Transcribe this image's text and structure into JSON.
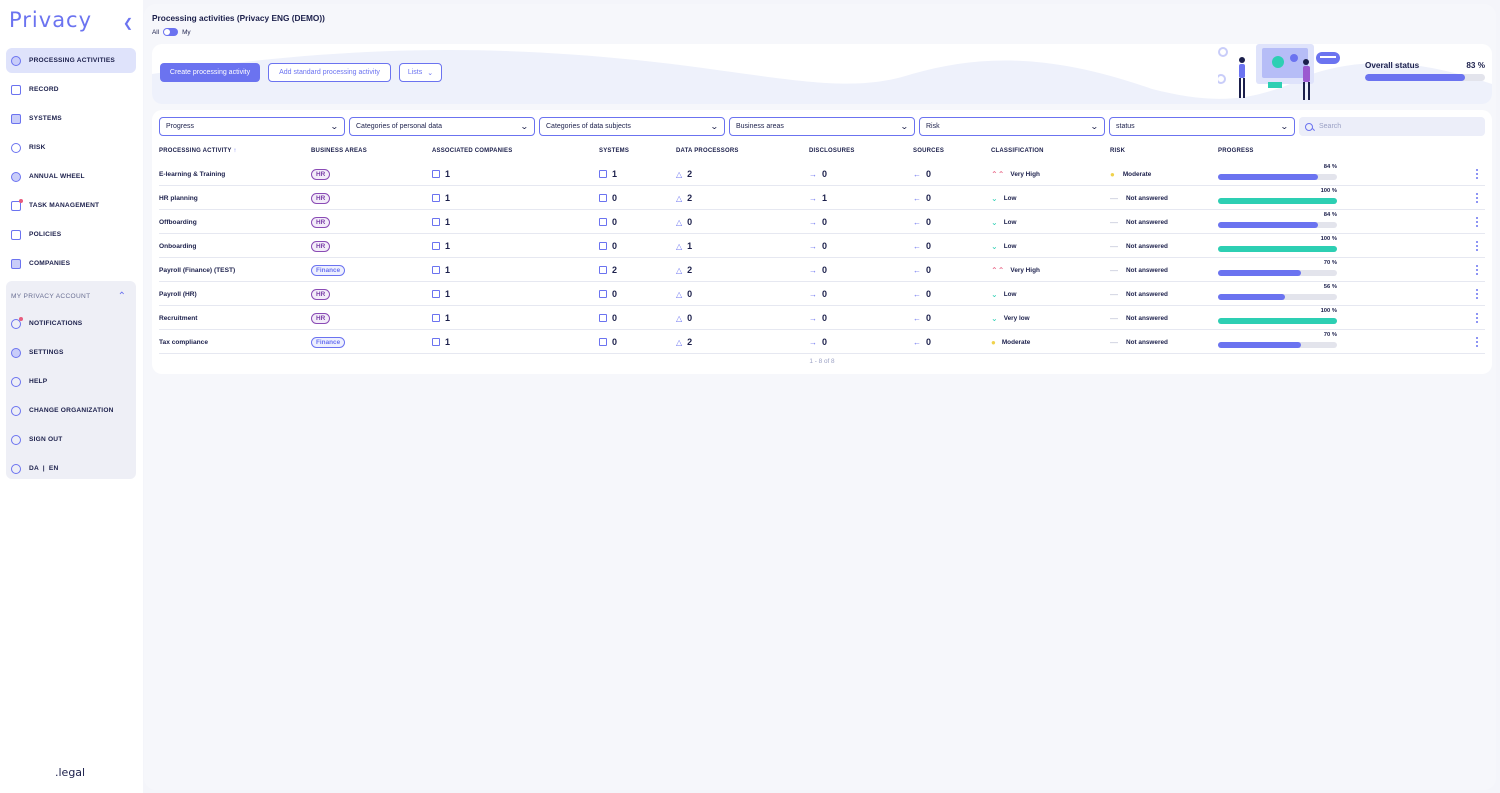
{
  "app": {
    "logo": "Privacy",
    "brand": ".legal",
    "accent": "#6b73f0"
  },
  "sidebar": {
    "items": [
      {
        "label": "PROCESSING ACTIVITIES",
        "icon": "fingerprint-icon",
        "active": true
      },
      {
        "label": "RECORD",
        "icon": "document-icon"
      },
      {
        "label": "SYSTEMS",
        "icon": "systems-icon"
      },
      {
        "label": "RISK",
        "icon": "gauge-icon"
      },
      {
        "label": "ANNUAL WHEEL",
        "icon": "wheel-icon"
      },
      {
        "label": "TASK MANAGEMENT",
        "icon": "tasks-icon"
      },
      {
        "label": "POLICIES",
        "icon": "policies-icon"
      },
      {
        "label": "COMPANIES",
        "icon": "companies-icon"
      }
    ],
    "account": {
      "title": "MY PRIVACY ACCOUNT",
      "items": [
        {
          "label": "NOTIFICATIONS",
          "icon": "bell-icon"
        },
        {
          "label": "SETTINGS",
          "icon": "gear-icon"
        },
        {
          "label": "HELP",
          "icon": "help-icon"
        },
        {
          "label": "CHANGE ORGANIZATION",
          "icon": "swap-icon"
        },
        {
          "label": "SIGN OUT",
          "icon": "sign-out-icon"
        },
        {
          "label": "DA  |  EN",
          "icon": "globe-icon"
        }
      ]
    }
  },
  "header": {
    "title": "Processing activities (Privacy ENG (DEMO))",
    "toggle_left": "All",
    "toggle_right": "My"
  },
  "toolbar": {
    "create": "Create processing activity",
    "add_standard": "Add standard processing activity",
    "lists": "Lists"
  },
  "overall": {
    "label": "Overall status",
    "percent_text": "83 %",
    "value": 83
  },
  "filters": {
    "items": [
      "Progress",
      "Categories of personal data",
      "Categories of data subjects",
      "Business areas",
      "Risk",
      "status"
    ],
    "search_placeholder": "Search"
  },
  "table": {
    "columns": [
      "PROCESSING ACTIVITY",
      "BUSINESS AREAS",
      "ASSOCIATED COMPANIES",
      "SYSTEMS",
      "DATA PROCESSORS",
      "DISCLOSURES",
      "SOURCES",
      "CLASSIFICATION",
      "RISK",
      "PROGRESS"
    ],
    "rows": [
      {
        "name": "E-learning & Training",
        "area": "HR",
        "companies": "1",
        "systems": "1",
        "processors": "2",
        "disclosures": "0",
        "sources": "0",
        "classification": "Very High",
        "class_icon": "double-up",
        "risk": "Moderate",
        "risk_icon": "dot",
        "progress": 84,
        "progress_text": "84 %"
      },
      {
        "name": "HR planning",
        "area": "HR",
        "companies": "1",
        "systems": "0",
        "processors": "2",
        "disclosures": "1",
        "sources": "0",
        "classification": "Low",
        "class_icon": "down",
        "risk": "Not answered",
        "risk_icon": "dash",
        "progress": 100,
        "progress_text": "100 %"
      },
      {
        "name": "Offboarding",
        "area": "HR",
        "companies": "1",
        "systems": "0",
        "processors": "0",
        "disclosures": "0",
        "sources": "0",
        "classification": "Low",
        "class_icon": "down",
        "risk": "Not answered",
        "risk_icon": "dash",
        "progress": 84,
        "progress_text": "84 %"
      },
      {
        "name": "Onboarding",
        "area": "HR",
        "companies": "1",
        "systems": "0",
        "processors": "1",
        "disclosures": "0",
        "sources": "0",
        "classification": "Low",
        "class_icon": "down",
        "risk": "Not answered",
        "risk_icon": "dash",
        "progress": 100,
        "progress_text": "100 %"
      },
      {
        "name": "Payroll (Finance) (TEST)",
        "area": "Finance",
        "companies": "1",
        "systems": "2",
        "processors": "2",
        "disclosures": "0",
        "sources": "0",
        "classification": "Very High",
        "class_icon": "double-up",
        "risk": "Not answered",
        "risk_icon": "dash",
        "progress": 70,
        "progress_text": "70 %"
      },
      {
        "name": "Payroll (HR)",
        "area": "HR",
        "companies": "1",
        "systems": "0",
        "processors": "0",
        "disclosures": "0",
        "sources": "0",
        "classification": "Low",
        "class_icon": "down",
        "risk": "Not answered",
        "risk_icon": "dash",
        "progress": 56,
        "progress_text": "56 %"
      },
      {
        "name": "Recruitment",
        "area": "HR",
        "companies": "1",
        "systems": "0",
        "processors": "0",
        "disclosures": "0",
        "sources": "0",
        "classification": "Very low",
        "class_icon": "double-down",
        "risk": "Not answered",
        "risk_icon": "dash",
        "progress": 100,
        "progress_text": "100 %"
      },
      {
        "name": "Tax compliance",
        "area": "Finance",
        "companies": "1",
        "systems": "0",
        "processors": "2",
        "disclosures": "0",
        "sources": "0",
        "classification": "Moderate",
        "class_icon": "dot",
        "risk": "Not answered",
        "risk_icon": "dash",
        "progress": 70,
        "progress_text": "70 %"
      }
    ],
    "pagination": "1 - 8 of 8"
  },
  "colors": {
    "progress_partial": "#6b73f0",
    "progress_full": "#2dcfb3",
    "very_high": "#e75c7e",
    "moderate": "#f0d24c"
  }
}
